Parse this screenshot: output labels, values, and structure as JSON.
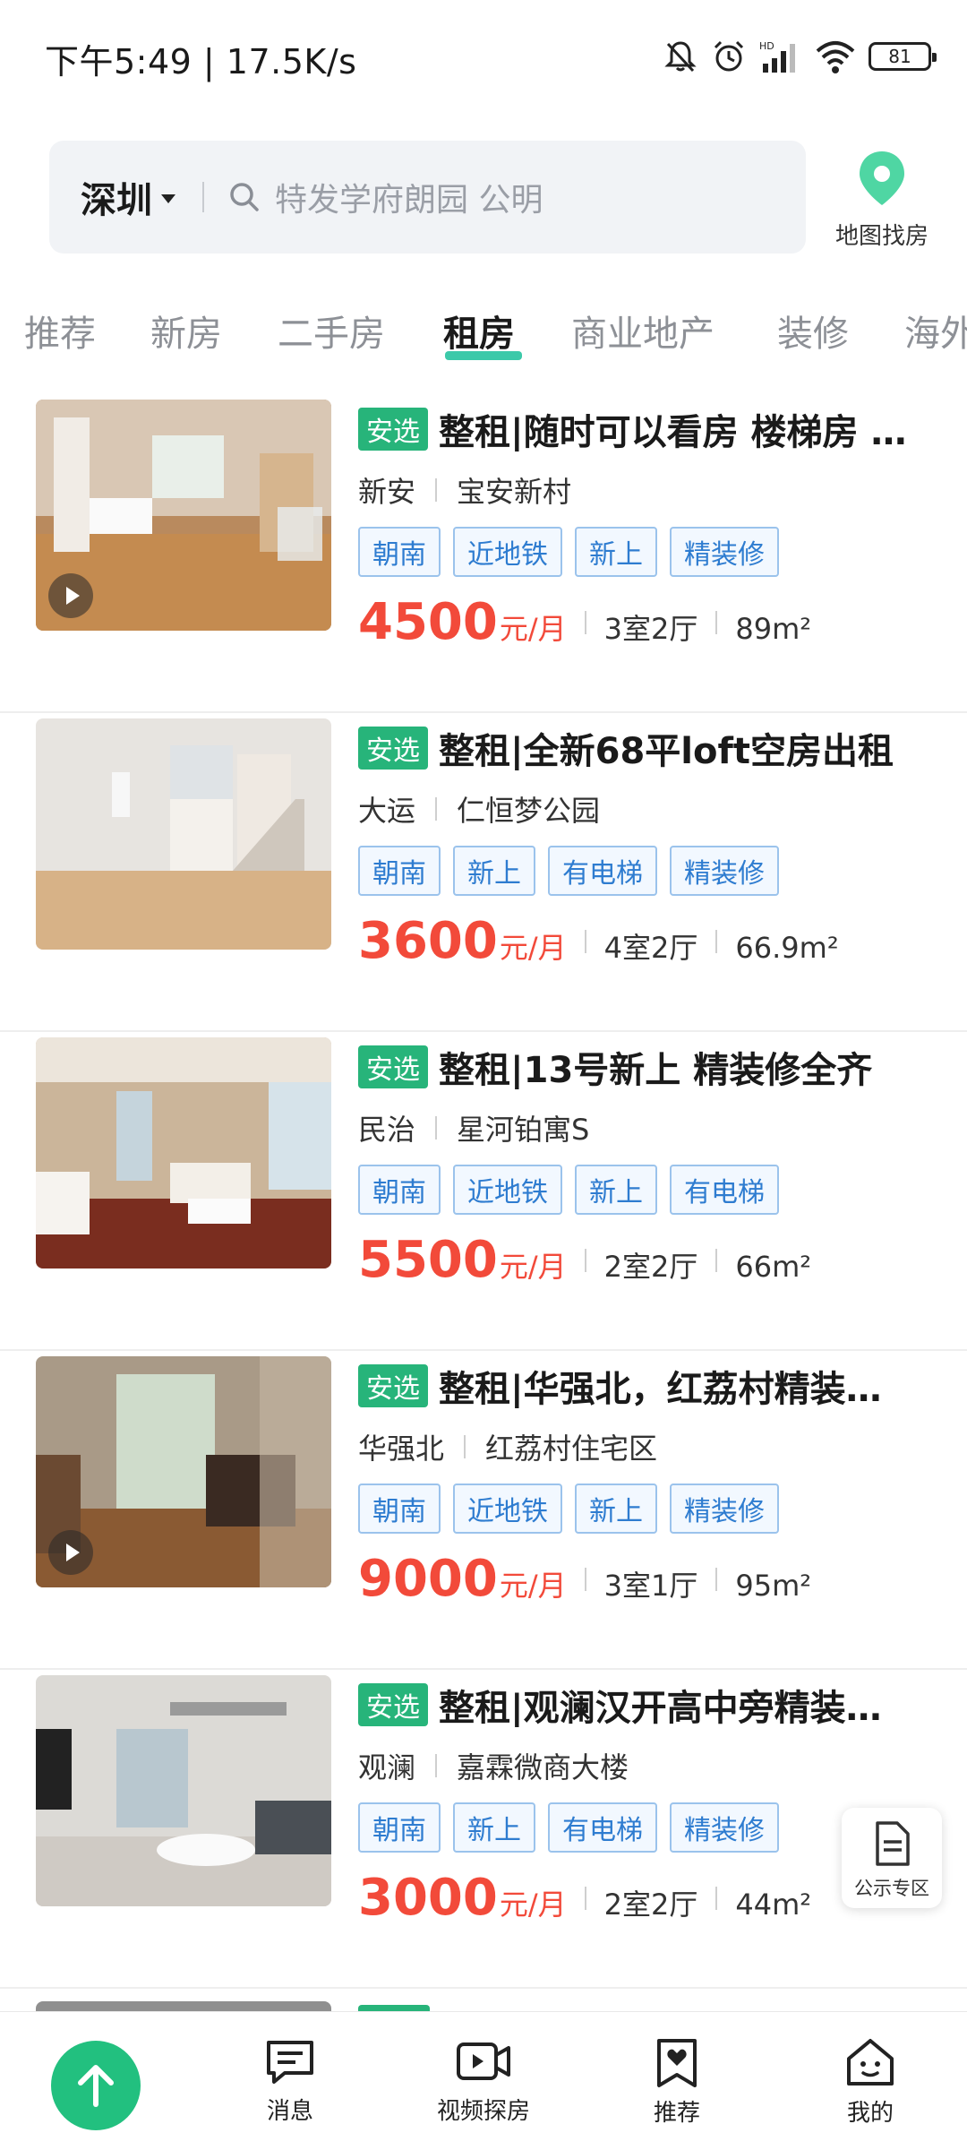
{
  "status_bar": {
    "time": "下午5:49 | 17.5K/s",
    "battery": "81"
  },
  "search": {
    "city": "深圳",
    "placeholder": "特发学府朗园 公明"
  },
  "map_button": {
    "label": "地图找房"
  },
  "tabs": [
    {
      "label": "推荐"
    },
    {
      "label": "新房"
    },
    {
      "label": "二手房"
    },
    {
      "label": "租房"
    },
    {
      "label": "商业地产"
    },
    {
      "label": "装修"
    },
    {
      "label": "海外"
    }
  ],
  "active_tab": "租房",
  "listings": [
    {
      "badge": "安选",
      "title": "整租|随时可以看房 楼梯房 精装修",
      "district": "新安",
      "community": "宝安新村",
      "tags": [
        "朝南",
        "近地铁",
        "新上",
        "精装修"
      ],
      "price": "4500",
      "price_unit": "元/月",
      "layout": "3室2厅",
      "area": "89m²",
      "has_video": true
    },
    {
      "badge": "安选",
      "title": "整租|全新68平loft空房出租",
      "district": "大运",
      "community": "仁恒梦公园",
      "tags": [
        "朝南",
        "新上",
        "有电梯",
        "精装修"
      ],
      "price": "3600",
      "price_unit": "元/月",
      "layout": "4室2厅",
      "area": "66.9m²",
      "has_video": false
    },
    {
      "badge": "安选",
      "title": "整租|13号新上 精装修全齐",
      "district": "民治",
      "community": "星河铂寓S",
      "tags": [
        "朝南",
        "近地铁",
        "新上",
        "有电梯"
      ],
      "price": "5500",
      "price_unit": "元/月",
      "layout": "2室2厅",
      "area": "66m²",
      "has_video": false
    },
    {
      "badge": "安选",
      "title": "整租|华强北，红荔村精装三房",
      "district": "华强北",
      "community": "红荔村住宅区",
      "tags": [
        "朝南",
        "近地铁",
        "新上",
        "精装修"
      ],
      "price": "9000",
      "price_unit": "元/月",
      "layout": "3室1厅",
      "area": "95m²",
      "has_video": true
    },
    {
      "badge": "安选",
      "title": "整租|观澜汉开高中旁精装两房",
      "district": "观澜",
      "community": "嘉霖微商大楼",
      "tags": [
        "朝南",
        "新上",
        "有电梯",
        "精装修"
      ],
      "price": "3000",
      "price_unit": "元/月",
      "layout": "2室2厅",
      "area": "44m²",
      "has_video": false
    }
  ],
  "notice_button": {
    "label": "公示专区"
  },
  "bottom_nav": [
    {
      "label": "消息"
    },
    {
      "label": "视频探房"
    },
    {
      "label": "推荐"
    },
    {
      "label": "我的"
    }
  ],
  "colors": {
    "brand_green": "#22c07f",
    "price_red": "#f24a3a",
    "tag_blue": "#2e7cd0"
  }
}
